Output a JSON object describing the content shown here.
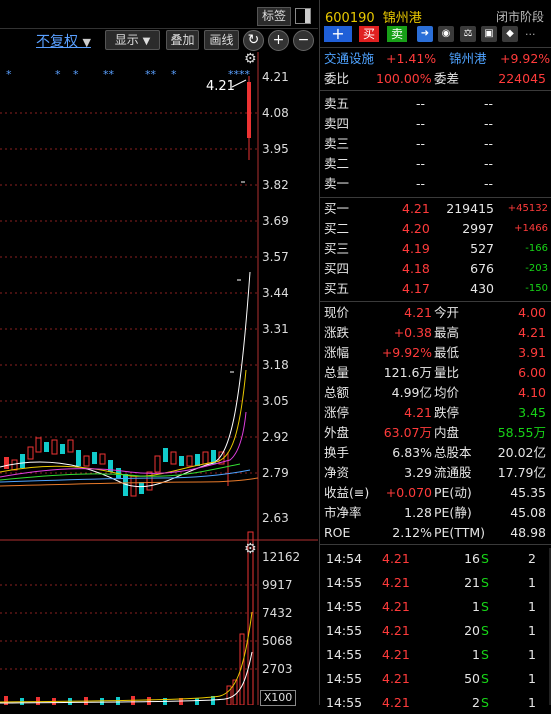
{
  "toolbar": {
    "tag_label": "标签",
    "fuquan_label": "不复权",
    "display_label": "显示",
    "draw_label": "画线",
    "painting_label": "画线"
  },
  "chart": {
    "price_axis": [
      "4.21",
      "4.08",
      "3.95",
      "3.82",
      "3.69",
      "3.57",
      "3.44",
      "3.31",
      "3.18",
      "3.05",
      "2.92",
      "2.79",
      "2.63"
    ],
    "last_price_tag": "4.21",
    "volume_axis": [
      "12162",
      "9917",
      "7432",
      "5068",
      "2703"
    ],
    "volume_unit": "X100"
  },
  "stock": {
    "code": "600190",
    "name": "锦州港",
    "status": "闭市阶段",
    "buy_label": "买",
    "sell_label": "卖"
  },
  "related": {
    "sector_name": "交通设施",
    "sector_change": "+1.41%",
    "stock_name": "锦州港",
    "stock_change": "+9.92%"
  },
  "ratio": {
    "webi_label": "委比",
    "webi_value": "100.00%",
    "weicha_label": "委差",
    "weicha_value": "224045"
  },
  "sell_orders": [
    {
      "label": "卖五",
      "price": "--",
      "vol": "--"
    },
    {
      "label": "卖四",
      "price": "--",
      "vol": "--"
    },
    {
      "label": "卖三",
      "price": "--",
      "vol": "--"
    },
    {
      "label": "卖二",
      "price": "--",
      "vol": "--"
    },
    {
      "label": "卖一",
      "price": "--",
      "vol": "--"
    }
  ],
  "buy_orders": [
    {
      "label": "买一",
      "price": "4.21",
      "vol": "219415",
      "chg": "+45132"
    },
    {
      "label": "买二",
      "price": "4.20",
      "vol": "2997",
      "chg": "+1466"
    },
    {
      "label": "买三",
      "price": "4.19",
      "vol": "527",
      "chg": "-166"
    },
    {
      "label": "买四",
      "price": "4.18",
      "vol": "676",
      "chg": "-203"
    },
    {
      "label": "买五",
      "price": "4.17",
      "vol": "430",
      "chg": "-150"
    }
  ],
  "quote": [
    {
      "l1": "现价",
      "v1": "4.21",
      "l2": "今开",
      "v2": "4.00"
    },
    {
      "l1": "涨跌",
      "v1": "+0.38",
      "l2": "最高",
      "v2": "4.21"
    },
    {
      "l1": "涨幅",
      "v1": "+9.92%",
      "l2": "最低",
      "v2": "3.91"
    },
    {
      "l1": "总量",
      "v1": "121.6万",
      "l2": "量比",
      "v2": "6.00"
    },
    {
      "l1": "总额",
      "v1": "4.99亿",
      "l2": "均价",
      "v2": "4.10"
    },
    {
      "l1": "涨停",
      "v1": "4.21",
      "l2": "跌停",
      "v2": "3.45"
    },
    {
      "l1": "外盘",
      "v1": "63.07万",
      "l2": "内盘",
      "v2": "58.55万"
    },
    {
      "l1": "换手",
      "v1": "6.83%",
      "l2": "总股本",
      "v2": "20.02亿"
    },
    {
      "l1": "净资",
      "v1": "3.29",
      "l2": "流通股",
      "v2": "17.79亿"
    },
    {
      "l1": "收益(≡)",
      "v1": "+0.070",
      "l2": "PE(动)",
      "v2": "45.35"
    },
    {
      "l1": "市净率",
      "v1": "1.28",
      "l2": "PE(静)",
      "v2": "45.08"
    },
    {
      "l1": "ROE",
      "v1": "2.12%",
      "l2": "PE(TTM)",
      "v2": "48.98"
    }
  ],
  "ticks": [
    {
      "time": "14:54",
      "price": "4.21",
      "vol": "16",
      "flag": "S",
      "n": "2"
    },
    {
      "time": "14:55",
      "price": "4.21",
      "vol": "21",
      "flag": "S",
      "n": "1"
    },
    {
      "time": "14:55",
      "price": "4.21",
      "vol": "1",
      "flag": "S",
      "n": "1"
    },
    {
      "time": "14:55",
      "price": "4.21",
      "vol": "20",
      "flag": "S",
      "n": "1"
    },
    {
      "time": "14:55",
      "price": "4.21",
      "vol": "1",
      "flag": "S",
      "n": "1"
    },
    {
      "time": "14:55",
      "price": "4.21",
      "vol": "50",
      "flag": "S",
      "n": "1"
    },
    {
      "time": "14:55",
      "price": "4.21",
      "vol": "2",
      "flag": "S",
      "n": "1"
    }
  ]
}
